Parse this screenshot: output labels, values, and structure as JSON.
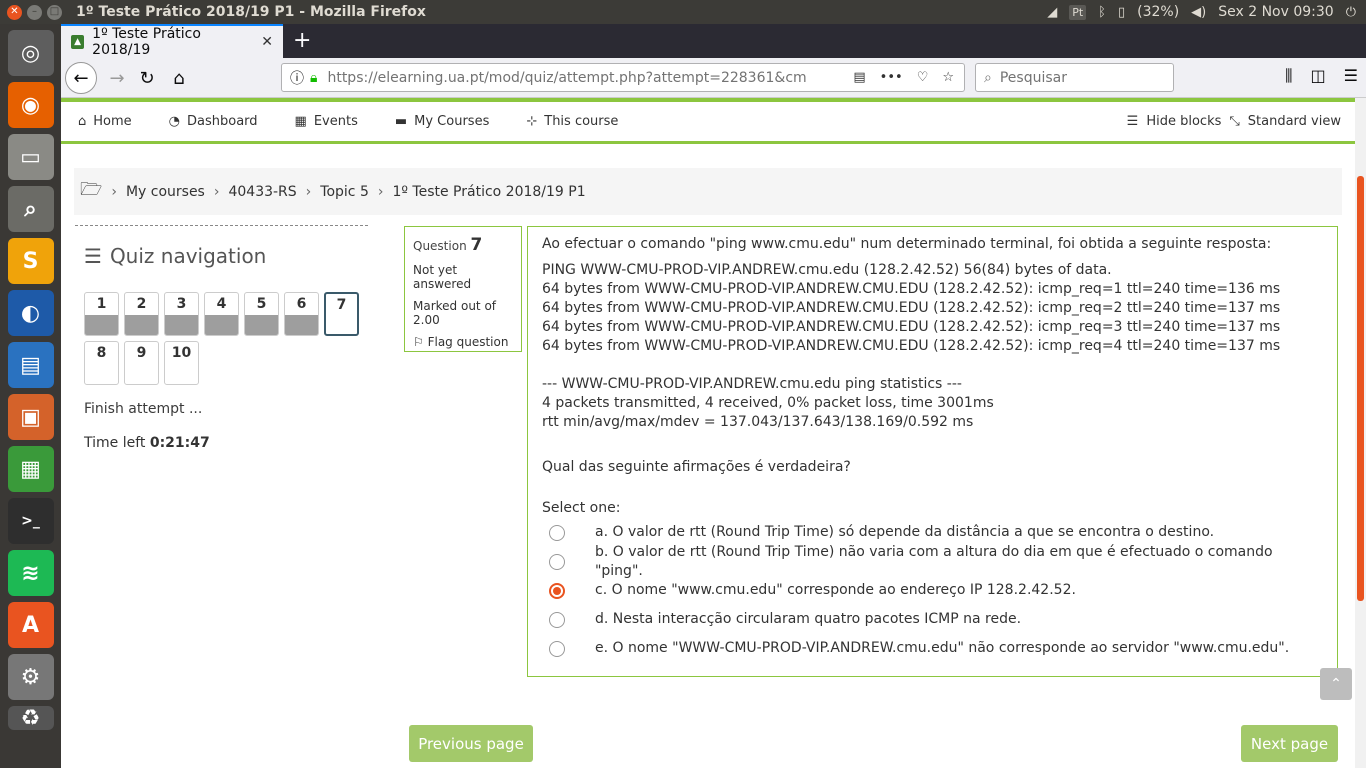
{
  "os": {
    "window_title": "1º Teste Prático 2018/19 P1 - Mozilla Firefox",
    "battery": "(32%)",
    "clock": "Sex  2 Nov 09:30",
    "pt_badge": "Pt"
  },
  "browser": {
    "tab_title": "1º Teste Prático 2018/19",
    "url": "https://elearning.ua.pt/mod/quiz/attempt.php?attempt=228361&cm",
    "search_placeholder": "Pesquisar"
  },
  "site_nav": {
    "items": [
      {
        "label": "Home",
        "icon": "home-icon"
      },
      {
        "label": "Dashboard",
        "icon": "dashboard-icon"
      },
      {
        "label": "Events",
        "icon": "calendar-icon"
      },
      {
        "label": "My Courses",
        "icon": "briefcase-icon"
      },
      {
        "label": "This course",
        "icon": "sitemap-icon"
      }
    ],
    "hide_blocks": "Hide blocks",
    "standard_view": "Standard view"
  },
  "breadcrumb": [
    "My courses",
    "40433-RS",
    "Topic 5",
    "1º Teste Prático 2018/19 P1"
  ],
  "quiz_nav": {
    "title": "Quiz navigation",
    "questions": [
      {
        "n": "1",
        "state": "answered"
      },
      {
        "n": "2",
        "state": "answered"
      },
      {
        "n": "3",
        "state": "answered"
      },
      {
        "n": "4",
        "state": "answered"
      },
      {
        "n": "5",
        "state": "answered"
      },
      {
        "n": "6",
        "state": "answered"
      },
      {
        "n": "7",
        "state": "current"
      },
      {
        "n": "8",
        "state": "empty"
      },
      {
        "n": "9",
        "state": "empty"
      },
      {
        "n": "10",
        "state": "empty"
      }
    ],
    "finish": "Finish attempt ...",
    "time_label": "Time left",
    "time_value": "0:21:47"
  },
  "question_info": {
    "label": "Question",
    "number": "7",
    "status": "Not yet answered",
    "marked": "Marked out of 2.00",
    "flag": "Flag question"
  },
  "question": {
    "intro": "Ao efectuar o comando \"ping www.cmu.edu\" num determinado terminal, foi obtida a seguinte resposta:",
    "output": [
      "PING WWW-CMU-PROD-VIP.ANDREW.cmu.edu (128.2.42.52) 56(84) bytes of data.",
      "64 bytes from WWW-CMU-PROD-VIP.ANDREW.CMU.EDU (128.2.42.52): icmp_req=1 ttl=240 time=136 ms",
      "64 bytes from WWW-CMU-PROD-VIP.ANDREW.CMU.EDU (128.2.42.52): icmp_req=2 ttl=240 time=137 ms",
      "64 bytes from WWW-CMU-PROD-VIP.ANDREW.CMU.EDU (128.2.42.52): icmp_req=3 ttl=240 time=137 ms",
      "64 bytes from WWW-CMU-PROD-VIP.ANDREW.CMU.EDU (128.2.42.52): icmp_req=4 ttl=240 time=137 ms"
    ],
    "stats": [
      "--- WWW-CMU-PROD-VIP.ANDREW.cmu.edu ping statistics ---",
      "4 packets transmitted, 4 received, 0% packet loss, time 3001ms",
      "rtt min/avg/max/mdev = 137.043/137.643/138.169/0.592 ms"
    ],
    "prompt": "Qual das seguinte afirmações é verdadeira?",
    "select_one": "Select one:",
    "options": [
      {
        "text": "a. O valor de rtt (Round Trip Time) só depende da distância a que se encontra o destino.",
        "checked": false
      },
      {
        "text": "b. O valor de rtt (Round Trip Time) não varia com a altura do dia em que é efectuado o comando \"ping\".",
        "checked": false
      },
      {
        "text": "c. O nome \"www.cmu.edu\" corresponde ao endereço IP 128.2.42.52.",
        "checked": true
      },
      {
        "text": "d. Nesta interacção circularam quatro pacotes ICMP na rede.",
        "checked": false
      },
      {
        "text": "e. O nome \"WWW-CMU-PROD-VIP.ANDREW.cmu.edu\" não corresponde ao servidor \"www.cmu.edu\".",
        "checked": false
      }
    ]
  },
  "buttons": {
    "prev": "Previous page",
    "next": "Next page"
  },
  "colors": {
    "accent_green": "#8cc63f",
    "button_green": "#a3c96a",
    "ubuntu_orange": "#e95420"
  }
}
